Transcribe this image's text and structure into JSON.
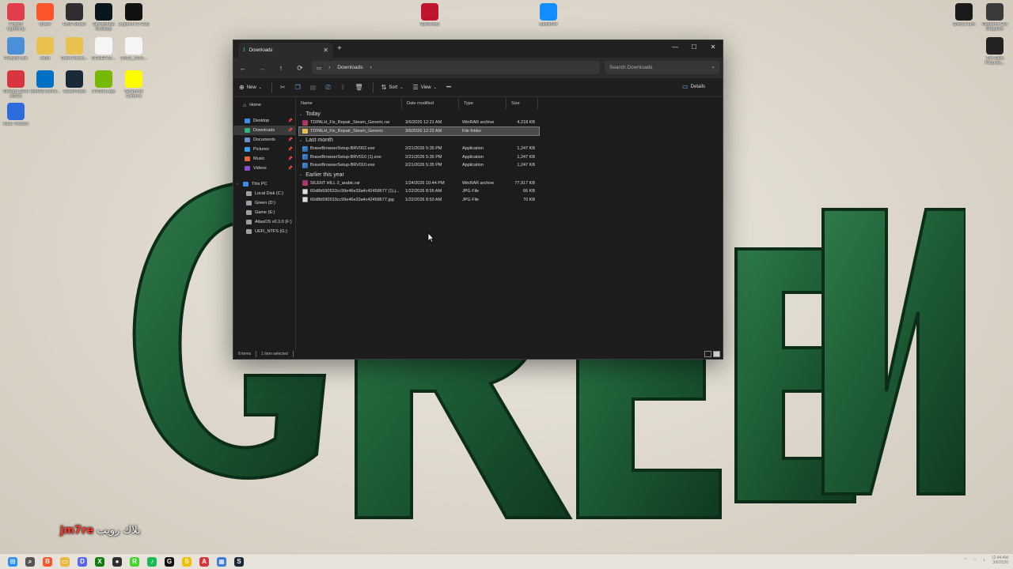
{
  "desktop": {
    "icons_left": [
      {
        "label": "Project Lightning",
        "icon": "project-lightning-icon",
        "color": "#e23d4a"
      },
      {
        "label": "Brave",
        "icon": "brave-icon",
        "color": "#fb542b"
      },
      {
        "label": "OBS Studio",
        "icon": "obs-icon",
        "color": "#302e31"
      },
      {
        "label": "Streamlabs Desktop",
        "icon": "streamlabs-icon",
        "color": "#09161d"
      },
      {
        "label": "Logitech G HUB",
        "icon": "logitech-icon",
        "color": "#111111"
      },
      {
        "label": "Recycle Bin",
        "icon": "recycle-bin-icon",
        "color": "#4a90d9"
      },
      {
        "label": "Atlas",
        "icon": "atlas-icon",
        "color": "#e8c14e"
      },
      {
        "label": "Dark.Horizo...",
        "icon": "folder-icon",
        "color": "#e8c14e"
      },
      {
        "label": "DRUEPA2...",
        "icon": "file-icon",
        "color": "#f5f5f5"
      },
      {
        "label": "D3D1_SCU...",
        "icon": "file-icon",
        "color": "#f5f5f5"
      },
      {
        "label": "Stream Deck ASCS",
        "icon": "stream-deck-icon",
        "color": "#d9353e"
      },
      {
        "label": "Intel(R) Driver...",
        "icon": "intel-icon",
        "color": "#0071c5"
      },
      {
        "label": "SteamTools",
        "icon": "steamtools-icon",
        "color": "#1b2838"
      },
      {
        "label": "NVIDIA App",
        "icon": "nvidia-icon",
        "color": "#76b900"
      },
      {
        "label": "Snapchat Camera",
        "icon": "snapchat-icon",
        "color": "#fffc00"
      },
      {
        "label": "Atlas Toolbox",
        "icon": "atlas-toolbox-icon",
        "color": "#2d6cdf"
      }
    ],
    "icons_top": [
      {
        "label": "ValoClose",
        "icon": "valo-icon",
        "color": "#c0152f"
      },
      {
        "label": "BattleNet",
        "icon": "battlenet-icon",
        "color": "#148eff"
      }
    ],
    "icons_right": [
      {
        "label": "Ghost Hunt",
        "icon": "ghost-hunt-icon",
        "color": "#1a1a1a"
      },
      {
        "label": "Resident Evil Requiem",
        "icon": "resident-evil-icon",
        "color": "#3a3a3a"
      },
      {
        "label": "The Dark Pictures...",
        "icon": "dark-pictures-icon",
        "color": "#222222"
      }
    ],
    "watermark_handle": "jm7re",
    "watermark_text": "بلاك رويب"
  },
  "window": {
    "tab_title": "Downloads",
    "address": {
      "segment": "Downloads"
    },
    "search_placeholder": "Search Downloads",
    "toolbar": {
      "new": "New",
      "sort": "Sort",
      "view": "View",
      "more": "•••",
      "details": "Details"
    },
    "nav": {
      "home": "Home",
      "quick_access": [
        {
          "label": "Desktop",
          "icon": "desktop-icon",
          "color": "#3a8ee6"
        },
        {
          "label": "Downloads",
          "icon": "downloads-icon",
          "color": "#2fb67c",
          "selected": true
        },
        {
          "label": "Documents",
          "icon": "documents-icon",
          "color": "#6b8fc9"
        },
        {
          "label": "Pictures",
          "icon": "pictures-icon",
          "color": "#3aa0e0"
        },
        {
          "label": "Music",
          "icon": "music-icon",
          "color": "#e0683a"
        },
        {
          "label": "Videos",
          "icon": "videos-icon",
          "color": "#8a4fd1"
        }
      ],
      "this_pc": "This PC",
      "drives": [
        {
          "label": "Local Disk (C:)"
        },
        {
          "label": "Green (D:)"
        },
        {
          "label": "Game (E:)"
        },
        {
          "label": "AtlasOS v0.3.0 (F:)"
        },
        {
          "label": "UEFI_NTFS (G:)"
        }
      ]
    },
    "columns": {
      "name": "Name",
      "date": "Date modified",
      "type": "Type",
      "size": "Size"
    },
    "groups": [
      {
        "title": "Today",
        "files": [
          {
            "name": "TDPALH_Fix_Repair_Steam_Generic.rar",
            "date": "3/6/2026 12:21 AM",
            "type": "WinRAR archive",
            "size": "4,218 KB",
            "kind": "rar"
          },
          {
            "name": "TDPALH_Fix_Repair_Steam_Generic",
            "date": "3/6/2026 12:22 AM",
            "type": "File folder",
            "size": "",
            "kind": "folder",
            "selected": true
          }
        ]
      },
      {
        "title": "Last month",
        "files": [
          {
            "name": "BraveBrowserSetup-BRV002.exe",
            "date": "2/21/2026 5:35 PM",
            "type": "Application",
            "size": "1,247 KB",
            "kind": "exe"
          },
          {
            "name": "BraveBrowserSetup-BRV010 (1).exe",
            "date": "2/21/2026 5:35 PM",
            "type": "Application",
            "size": "1,247 KB",
            "kind": "exe"
          },
          {
            "name": "BraveBrowserSetup-BRV010.exe",
            "date": "2/21/2026 5:35 PM",
            "type": "Application",
            "size": "1,247 KB",
            "kind": "exe"
          }
        ]
      },
      {
        "title": "Earlier this year",
        "files": [
          {
            "name": "SILENT HILL 2_arabic.rar",
            "date": "1/24/2026 10:44 PM",
            "type": "WinRAR archive",
            "size": "77,917 KB",
            "kind": "rar"
          },
          {
            "name": "60d8b590533cc99e46e33a4c42458677 (1).j...",
            "date": "1/22/2026 8:55 AM",
            "type": "JPG File",
            "size": "66 KB",
            "kind": "jpg"
          },
          {
            "name": "60d8b590533cc99e46e33a4c42458677.jpg",
            "date": "1/22/2026 8:53 AM",
            "type": "JPG File",
            "size": "70 KB",
            "kind": "jpg"
          }
        ]
      }
    ],
    "status": {
      "count": "8 items",
      "selected": "1 item selected"
    }
  },
  "taskbar": {
    "apps": [
      {
        "icon": "start-icon",
        "color": "#2f8ff0",
        "glyph": "⊞"
      },
      {
        "icon": "search-icon",
        "color": "#555555",
        "glyph": "⌕"
      },
      {
        "icon": "brave-icon",
        "color": "#fb542b",
        "glyph": "B"
      },
      {
        "icon": "file-explorer-icon",
        "color": "#e8b93e",
        "glyph": "▭"
      },
      {
        "icon": "discord-icon",
        "color": "#5865f2",
        "glyph": "D"
      },
      {
        "icon": "xbox-icon",
        "color": "#107c10",
        "glyph": "X"
      },
      {
        "icon": "obs-icon",
        "color": "#302e31",
        "glyph": "●"
      },
      {
        "icon": "razer-icon",
        "color": "#44d62c",
        "glyph": "R"
      },
      {
        "icon": "spotify-icon",
        "color": "#1db954",
        "glyph": "♪"
      },
      {
        "icon": "logitech-icon",
        "color": "#111111",
        "glyph": "G"
      },
      {
        "icon": "snapchat-icon",
        "color": "#f0c000",
        "glyph": "S"
      },
      {
        "icon": "stream-deck-icon",
        "color": "#d9353e",
        "glyph": "A"
      },
      {
        "icon": "settings-app-icon",
        "color": "#3a7bd5",
        "glyph": "▦"
      },
      {
        "icon": "steam-icon",
        "color": "#1b2838",
        "glyph": "S"
      }
    ],
    "time": "12:44 AM",
    "date": "3/6/2026"
  }
}
